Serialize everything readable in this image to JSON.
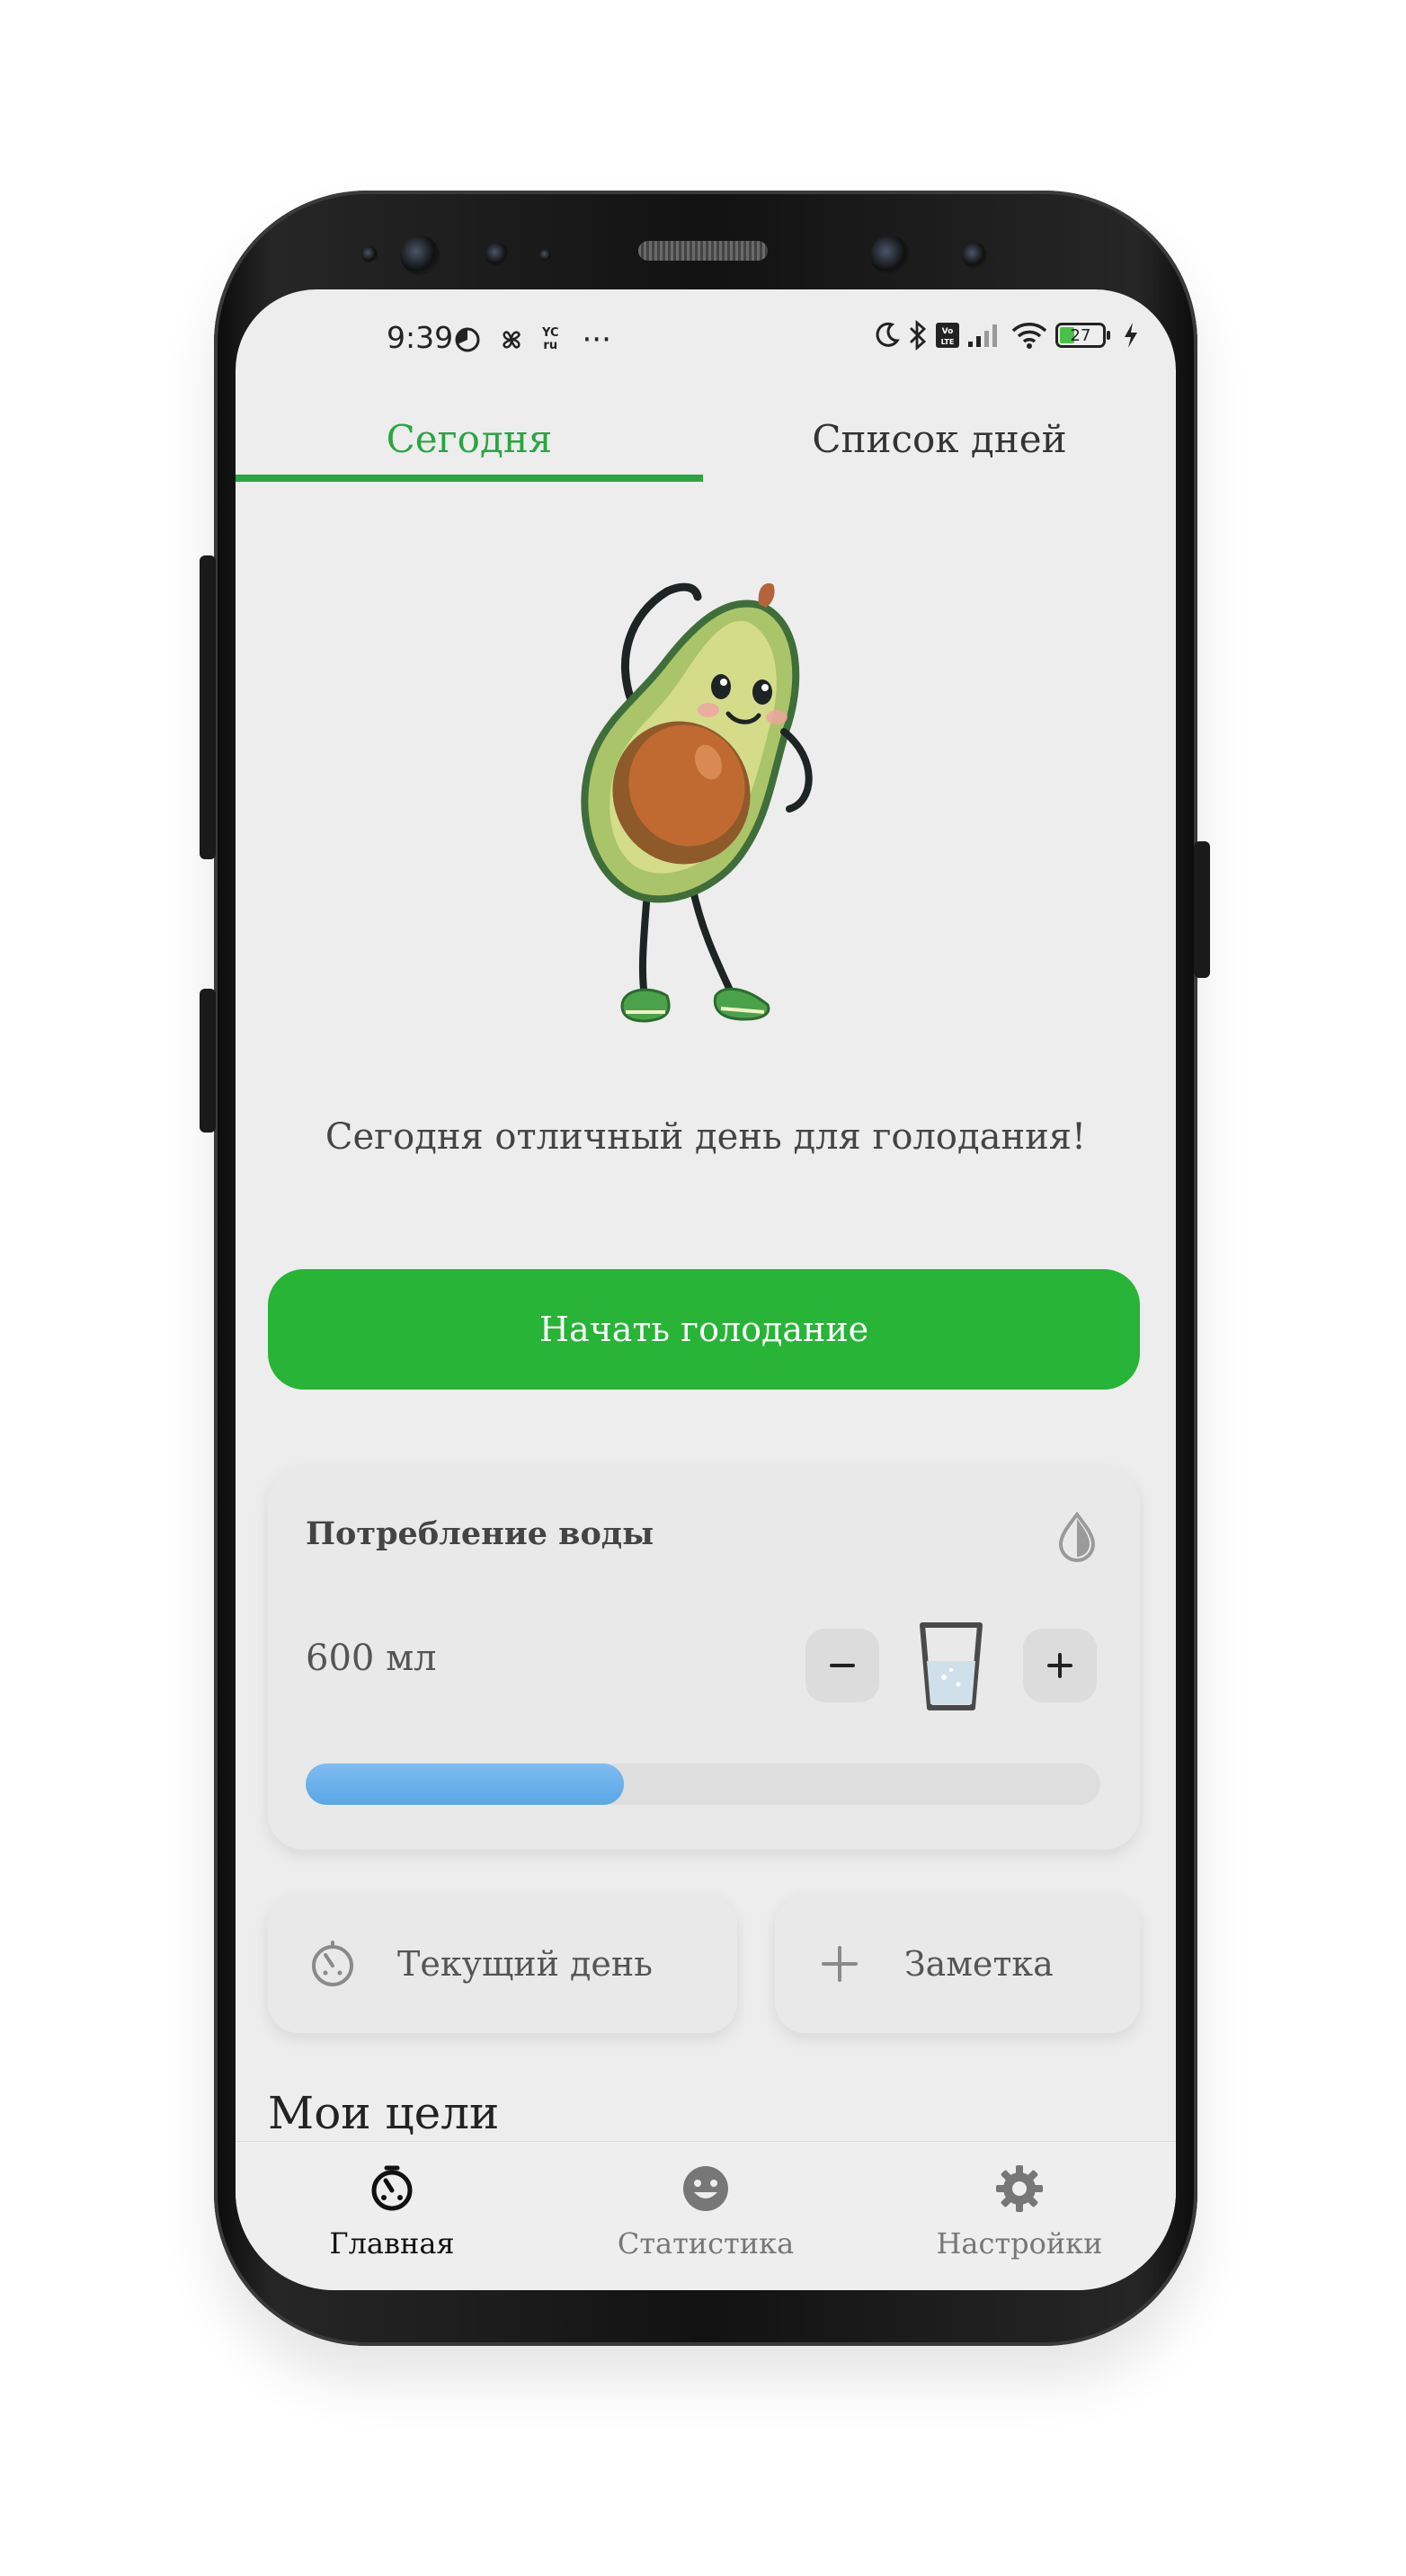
{
  "status_bar": {
    "time": "9:39",
    "ycru_top": "YC",
    "ycru_bottom": "ru",
    "overflow": "···",
    "battery_level": "27"
  },
  "tabs": [
    {
      "label": "Сегодня",
      "active": true
    },
    {
      "label": "Список дней",
      "active": false
    }
  ],
  "main": {
    "slogan": "Сегодня отличный день для голодания!",
    "start_button": "Начать голодание"
  },
  "water": {
    "title": "Потребление воды",
    "amount": "600 мл",
    "progress_fraction": 0.4
  },
  "actions": {
    "current_day": "Текущий день",
    "note": "Заметка"
  },
  "goals": {
    "title": "Мои цели"
  },
  "bottom_nav": [
    {
      "label": "Главная",
      "icon": "timer-icon",
      "active": true
    },
    {
      "label": "Статистика",
      "icon": "smile-icon",
      "active": false
    },
    {
      "label": "Настройки",
      "icon": "gear-icon",
      "active": false
    }
  ],
  "colors": {
    "accent": "#27b437",
    "tab_active": "#2aa541",
    "water_progress": "#5aa6e6"
  }
}
